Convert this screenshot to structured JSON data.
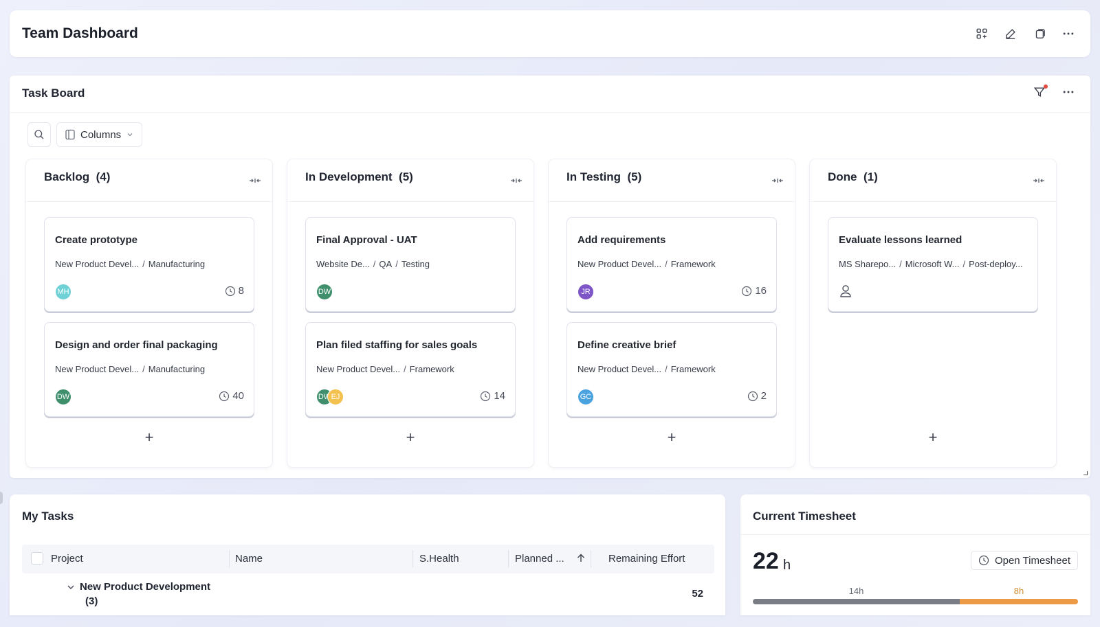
{
  "header": {
    "title": "Team Dashboard",
    "icons": [
      "add-widget-icon",
      "edit-icon",
      "copy-icon",
      "more-icon"
    ]
  },
  "task_board": {
    "title": "Task Board",
    "toolbar": {
      "columns_label": "Columns"
    },
    "columns": [
      {
        "title": "Backlog",
        "count": "(4)",
        "cards": [
          {
            "title": "Create prototype",
            "path": [
              "New Product Devel...",
              "Manufacturing"
            ],
            "avatars": [
              {
                "initials": "MH",
                "color": "#6fd0d6"
              }
            ],
            "effort": "8"
          },
          {
            "title": "Design and order final packaging",
            "path": [
              "New Product Devel...",
              "Manufacturing"
            ],
            "avatars": [
              {
                "initials": "DW",
                "color": "#3f8f6c"
              }
            ],
            "effort": "40"
          }
        ]
      },
      {
        "title": "In Development",
        "count": "(5)",
        "cards": [
          {
            "title": "Final Approval - UAT",
            "path": [
              "Website De...",
              "QA",
              "Testing"
            ],
            "avatars": [
              {
                "initials": "DW",
                "color": "#3f8f6c"
              }
            ],
            "effort": ""
          },
          {
            "title": "Plan filed staffing for sales goals",
            "path": [
              "New Product Devel...",
              "Framework"
            ],
            "avatars": [
              {
                "initials": "DW",
                "color": "#3f8f6c"
              },
              {
                "initials": "EJ",
                "color": "#f2c14e"
              }
            ],
            "effort": "14"
          }
        ]
      },
      {
        "title": "In Testing",
        "count": "(5)",
        "cards": [
          {
            "title": "Add requirements",
            "path": [
              "New Product Devel...",
              "Framework"
            ],
            "avatars": [
              {
                "initials": "JR",
                "color": "#7d55c7"
              }
            ],
            "effort": "16"
          },
          {
            "title": "Define creative brief",
            "path": [
              "New Product Devel...",
              "Framework"
            ],
            "avatars": [
              {
                "initials": "GC",
                "color": "#4aa3df"
              }
            ],
            "effort": "2"
          }
        ]
      },
      {
        "title": "Done",
        "count": "(1)",
        "cards": [
          {
            "title": "Evaluate lessons learned",
            "path": [
              "MS Sharepo...",
              "Microsoft W...",
              "Post-deploy..."
            ],
            "avatars": [],
            "effort": ""
          }
        ]
      }
    ],
    "add_label": "+"
  },
  "my_tasks": {
    "title": "My Tasks",
    "columns": [
      "Project",
      "Name",
      "S.Health",
      "Planned ...",
      "Remaining Effort"
    ],
    "groups": [
      {
        "name": "New Product Development",
        "count": "(3)",
        "remaining_effort": "52"
      }
    ]
  },
  "timesheet": {
    "title": "Current Timesheet",
    "hours": "22",
    "unit": "h",
    "open_label": "Open Timesheet",
    "segments": [
      {
        "label": "14h",
        "value": 14,
        "color": "#7a7d85"
      },
      {
        "label": "8h",
        "value": 8,
        "color": "#ec9a45"
      }
    ]
  }
}
